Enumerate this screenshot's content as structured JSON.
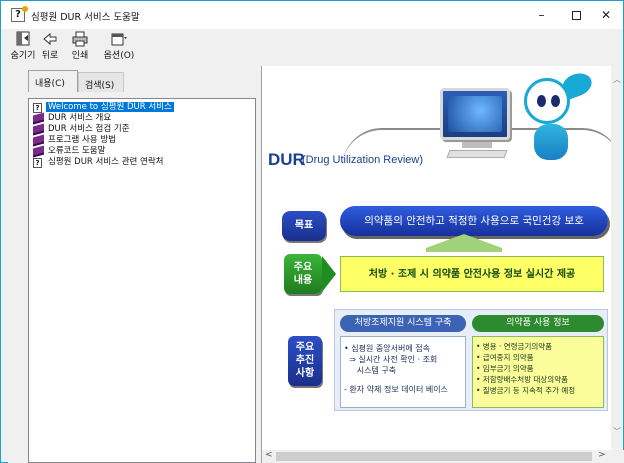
{
  "window": {
    "title": "심평원 DUR 서비스 도움말",
    "controls": {
      "minimize": "–",
      "maximize": "□",
      "close": "✕"
    }
  },
  "toolbar": {
    "hide": "숨기기",
    "back": "뒤로",
    "print": "인쇄",
    "options": "옵션(O)"
  },
  "tabs": {
    "contents": "내용(C)",
    "search": "검색(S)"
  },
  "tree": {
    "items": [
      {
        "label": "Welcome to 심평원 DUR 서비스",
        "icon": "help-page-icon",
        "selected": true
      },
      {
        "label": "DUR 서비스 개요",
        "icon": "book-icon"
      },
      {
        "label": "DUR 서비스 점검 기준",
        "icon": "book-icon"
      },
      {
        "label": "프로그램 사용 방법",
        "icon": "book-icon"
      },
      {
        "label": "오류코드 도움말",
        "icon": "book-icon"
      },
      {
        "label": "심평원 DUR 서비스 관련 연락처",
        "icon": "help-page-icon"
      }
    ]
  },
  "content": {
    "dur_title": "DUR",
    "dur_subtitle": "(Drug Utilization Review)",
    "goal": {
      "badge": "목표",
      "text": "의약품의 안전하고 적정한 사용으로 국민건강 보호"
    },
    "main_use": {
      "badge_line1": "주요",
      "badge_line2": "내용",
      "text": "처방 · 조제 시 의약품 안전사용 정보 실시간 제공"
    },
    "key_items": {
      "badge_line1": "주요",
      "badge_line2": "추진",
      "badge_line3": "사항",
      "system_header": "처방조제지원 시스템 구축",
      "system_items": [
        "• 심평원 중앙서버에 접속",
        "  ⇒ 실시간 사전 확인 · 조회",
        "     시스템 구축",
        "- 환자 약제 정보 데이터 베이스"
      ],
      "info_header": "의약품 사용 정보",
      "info_items": [
        "• 병용 · 연령금기의약품",
        "• 급여중지 의약품",
        "• 임부금기 의약품",
        "• 저함량배수처방 대상의약품",
        "• 질병금기 등 지속적 추가 예정"
      ]
    }
  },
  "colors": {
    "window_border": "#1e9fd0",
    "selection": "#0078d7",
    "dur_blue": "#1b3f8f",
    "goal_blue": "#2f5de0",
    "use_green": "#1e8c1e",
    "use_yellow": "#ffff66",
    "book_purple": "#7b2b8a"
  }
}
